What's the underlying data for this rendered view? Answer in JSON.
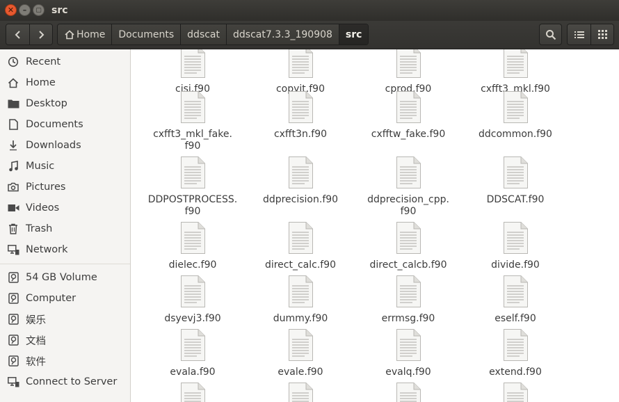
{
  "window": {
    "title": "src"
  },
  "breadcrumb": [
    "Home",
    "Documents",
    "ddscat",
    "ddscat7.3.3_190908",
    "src"
  ],
  "sidebar": {
    "places": [
      {
        "label": "Recent",
        "icon": "clock-icon"
      },
      {
        "label": "Home",
        "icon": "home-icon"
      },
      {
        "label": "Desktop",
        "icon": "folder-icon"
      },
      {
        "label": "Documents",
        "icon": "document-icon"
      },
      {
        "label": "Downloads",
        "icon": "download-icon"
      },
      {
        "label": "Music",
        "icon": "music-icon"
      },
      {
        "label": "Pictures",
        "icon": "camera-icon"
      },
      {
        "label": "Videos",
        "icon": "video-icon"
      },
      {
        "label": "Trash",
        "icon": "trash-icon"
      },
      {
        "label": "Network",
        "icon": "network-icon"
      }
    ],
    "devices": [
      {
        "label": "54 GB Volume",
        "icon": "drive-icon"
      },
      {
        "label": "Computer",
        "icon": "drive-icon"
      },
      {
        "label": "娱乐",
        "icon": "drive-icon"
      },
      {
        "label": "文档",
        "icon": "drive-icon"
      },
      {
        "label": "软件",
        "icon": "drive-icon"
      },
      {
        "label": "Connect to Server",
        "icon": "server-icon"
      }
    ]
  },
  "files": [
    [
      "cisi.f90",
      "copyit.f90",
      "cprod.f90",
      "cxfft3_mkl.f90"
    ],
    [
      "cxfft3_mkl_fake.\nf90",
      "cxfft3n.f90",
      "cxfftw_fake.f90",
      "ddcommon.f90"
    ],
    [
      "DDPOSTPROCESS.\nf90",
      "ddprecision.f90",
      "ddprecision_cpp.\nf90",
      "DDSCAT.f90"
    ],
    [
      "dielec.f90",
      "direct_calc.f90",
      "direct_calcb.f90",
      "divide.f90"
    ],
    [
      "dsyevj3.f90",
      "dummy.f90",
      "errmsg.f90",
      "eself.f90"
    ],
    [
      "evala.f90",
      "evale.f90",
      "evalq.f90",
      "extend.f90"
    ],
    [
      "",
      "",
      "",
      ""
    ]
  ]
}
